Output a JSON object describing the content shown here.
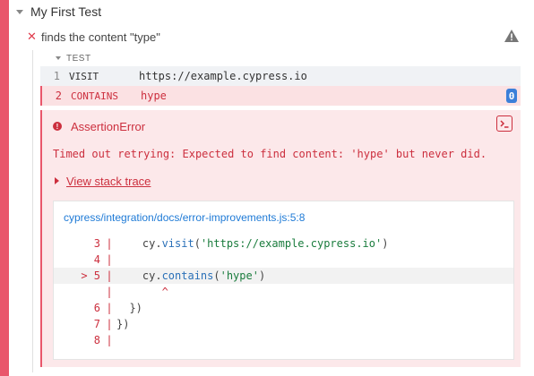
{
  "suite": {
    "title": "My First Test"
  },
  "test": {
    "title": "finds the content \"type\""
  },
  "section": {
    "label": "TEST"
  },
  "commands": [
    {
      "num": "1",
      "name": "VISIT",
      "message": "https://example.cypress.io"
    },
    {
      "num": "2",
      "name": "CONTAINS",
      "message": "hype",
      "badge": "0"
    }
  ],
  "error": {
    "name": "AssertionError",
    "message": "Timed out retrying: Expected to find content: 'hype' but never did.",
    "stack_link": "View stack trace",
    "code_frame": {
      "file": "cypress/integration/docs/error-improvements.js:5:8",
      "lines": [
        {
          "gutter": "3",
          "code_pre": "    cy.",
          "fn": "visit",
          "code_mid": "(",
          "str": "'https://example.cypress.io'",
          "code_post": ")"
        },
        {
          "gutter": "4",
          "code_pre": "",
          "fn": "",
          "code_mid": "",
          "str": "",
          "code_post": ""
        },
        {
          "gutter": "> 5",
          "code_pre": "    cy.",
          "fn": "contains",
          "code_mid": "(",
          "str": "'hype'",
          "code_post": ")"
        },
        {
          "gutter": "",
          "code_pre": "       ^",
          "fn": "",
          "code_mid": "",
          "str": "",
          "code_post": ""
        },
        {
          "gutter": "6",
          "code_pre": "  })",
          "fn": "",
          "code_mid": "",
          "str": "",
          "code_post": ""
        },
        {
          "gutter": "7",
          "code_pre": "})",
          "fn": "",
          "code_mid": "",
          "str": "",
          "code_post": ""
        },
        {
          "gutter": "8",
          "code_pre": "",
          "fn": "",
          "code_mid": "",
          "str": "",
          "code_post": ""
        }
      ]
    }
  },
  "colors": {
    "fail": "#e9566b",
    "error_text": "#cc2f3e",
    "link": "#1e7ad6",
    "badge": "#3b7fd9"
  },
  "icons": {
    "suite_toggle": "caret-down-icon",
    "test_state": "x-icon",
    "warning": "warning-icon",
    "error": "error-dot-icon",
    "print": "terminal-icon"
  }
}
